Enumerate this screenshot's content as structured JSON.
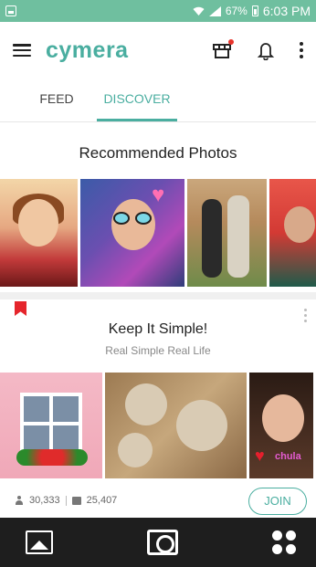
{
  "status_bar": {
    "battery": "67%",
    "time": "6:03 PM",
    "icons": [
      "screenshot-icon",
      "wifi-icon",
      "signal-icon",
      "battery-icon"
    ]
  },
  "app_bar": {
    "brand": "cymera",
    "icons": [
      "menu-icon",
      "shop-icon",
      "bell-icon",
      "more-icon"
    ],
    "accent_color": "#4aaea0",
    "notification_dot_color": "#e8342b"
  },
  "tabs": [
    {
      "label": "FEED",
      "active": false
    },
    {
      "label": "DISCOVER",
      "active": true
    }
  ],
  "recommended": {
    "title": "Recommended Photos"
  },
  "card": {
    "title": "Keep It Simple!",
    "subtitle": "Real Simple Real Life",
    "members": "30,333",
    "photos": "25,407",
    "join_label": "JOIN",
    "flag_color": "#e5252c"
  },
  "bottom_nav": {
    "icons": [
      "gallery-icon",
      "camera-icon",
      "grid-icon"
    ]
  }
}
